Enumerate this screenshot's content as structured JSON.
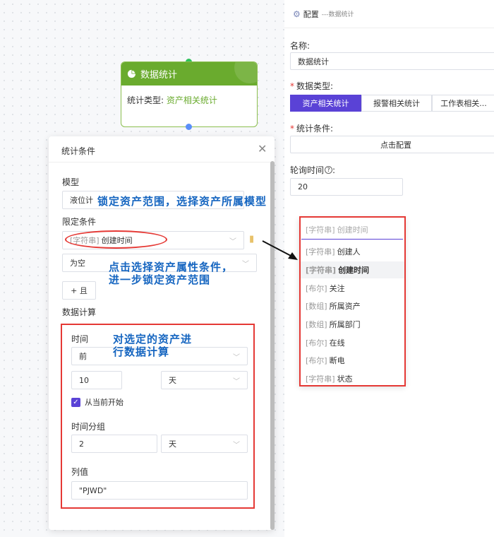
{
  "node": {
    "title": "数据统计",
    "type_label": "统计类型:",
    "type_value": "资产相关统计"
  },
  "left_panel": {
    "title": "统计条件",
    "model_label": "模型",
    "model_value": "液位计",
    "condition_label": "限定条件",
    "condition_tag": "[字符串]",
    "condition_value": "创建时间",
    "op_value": "为空",
    "add_button": "+ 且",
    "calc_label": "数据计算",
    "time_label": "时间",
    "time_dir": "前",
    "time_num": "10",
    "time_unit": "天",
    "from_now_label": "从当前开始",
    "group_label": "时间分组",
    "group_num": "2",
    "group_unit": "天",
    "column_label": "列值",
    "column_value": "\"PJWD\""
  },
  "right_panel": {
    "header_title": "配置",
    "header_sub": "---数据统计",
    "name_label": "名称:",
    "name_value": "数据统计",
    "data_type_label": "数据类型:",
    "tabs": [
      "资产相关统计",
      "报警相关统计",
      "工作表相关..."
    ],
    "cond_label": "统计条件:",
    "cond_button": "点击配置",
    "poll_label": "轮询时间",
    "poll_value": "20"
  },
  "dropdown": {
    "search_tag": "[字符串]",
    "search_placeholder": "创建时间",
    "items": [
      {
        "tag": "[字符串]",
        "label": "创建人"
      },
      {
        "tag": "[字符串]",
        "label": "创建时间"
      },
      {
        "tag": "[布尔]",
        "label": "关注"
      },
      {
        "tag": "[数组]",
        "label": "所属资产"
      },
      {
        "tag": "[数组]",
        "label": "所属部门"
      },
      {
        "tag": "[布尔]",
        "label": "在线"
      },
      {
        "tag": "[布尔]",
        "label": "断电"
      },
      {
        "tag": "[字符串]",
        "label": "状态"
      }
    ]
  },
  "annotations": {
    "note1": "锁定资产范围，选择资产所属模型",
    "note2_line1": "点击选择资产属性条件，",
    "note2_line2": "进一步锁定资产范围",
    "note3_line1": "对选定的资产进",
    "note3_line2": "行数据计算"
  },
  "colors": {
    "accent": "#5a42d6",
    "node_green": "#6aab2e",
    "annotation_red": "#e53935",
    "annotation_blue": "#1565c0"
  }
}
